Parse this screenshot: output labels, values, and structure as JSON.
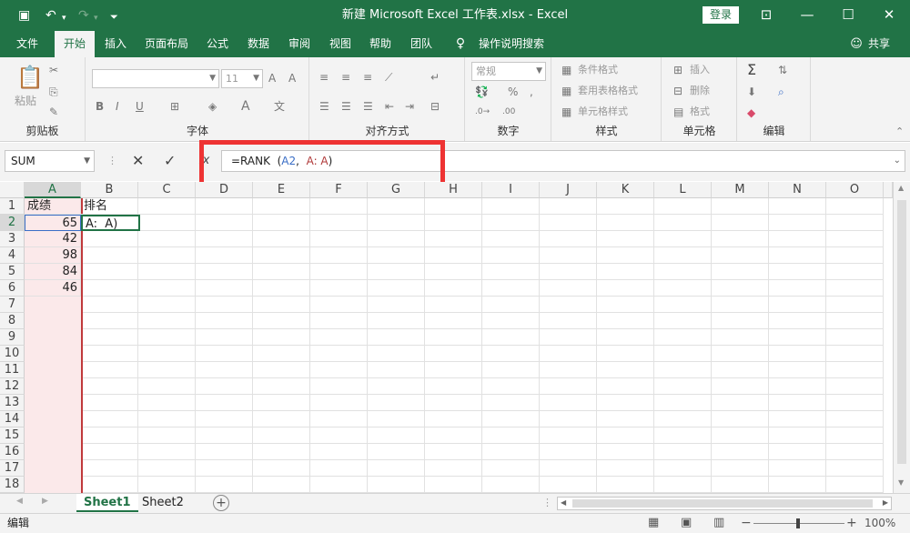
{
  "titlebar": {
    "title": "新建 Microsoft Excel 工作表.xlsx  -  Excel",
    "login": "登录",
    "save_icon": "save-icon",
    "undo_icon": "undo-icon",
    "redo_icon": "redo-icon"
  },
  "tabs": [
    "文件",
    "开始",
    "插入",
    "页面布局",
    "公式",
    "数据",
    "审阅",
    "视图",
    "帮助",
    "团队"
  ],
  "active_tab": "开始",
  "tell_me": "操作说明搜索",
  "share": "共享",
  "ribbon": {
    "clipboard": {
      "label": "剪贴板",
      "paste": "粘贴"
    },
    "font": {
      "label": "字体",
      "size": "11",
      "bold": "B",
      "italic": "I",
      "underline": "U"
    },
    "alignment": {
      "label": "对齐方式"
    },
    "number": {
      "label": "数字",
      "format": "常规"
    },
    "styles": {
      "label": "样式",
      "cond_format": "条件格式",
      "table_format": "套用表格格式",
      "cell_style": "单元格样式"
    },
    "cells": {
      "label": "单元格",
      "insert": "插入",
      "delete": "删除",
      "format": "格式"
    },
    "editing": {
      "label": "编辑"
    }
  },
  "formula_bar": {
    "name_box": "SUM",
    "formula_prefix": "=RANK  (",
    "formula_ref1": "A2",
    "formula_mid": ",  ",
    "formula_ref2": "A: A",
    "formula_suffix": ")"
  },
  "columns": [
    "A",
    "B",
    "C",
    "D",
    "E",
    "F",
    "G",
    "H",
    "I",
    "J",
    "K",
    "L",
    "M",
    "N",
    "O"
  ],
  "rows": [
    "1",
    "2",
    "3",
    "4",
    "5",
    "6",
    "7",
    "8",
    "9",
    "10",
    "11",
    "12",
    "13",
    "14",
    "15",
    "16",
    "17",
    "18"
  ],
  "cells": {
    "A1": "成绩",
    "B1": "排名",
    "A2": "65",
    "B2": "A:  A)",
    "A3": "42",
    "A4": "98",
    "A5": "84",
    "A6": "46"
  },
  "sheets": [
    "Sheet1",
    "Sheet2"
  ],
  "active_sheet": "Sheet1",
  "status": {
    "mode": "编辑",
    "zoom": "100%"
  },
  "colors": {
    "accent": "#217346",
    "highlight": "#e33333",
    "pink_fill": "#fbe9ea"
  }
}
